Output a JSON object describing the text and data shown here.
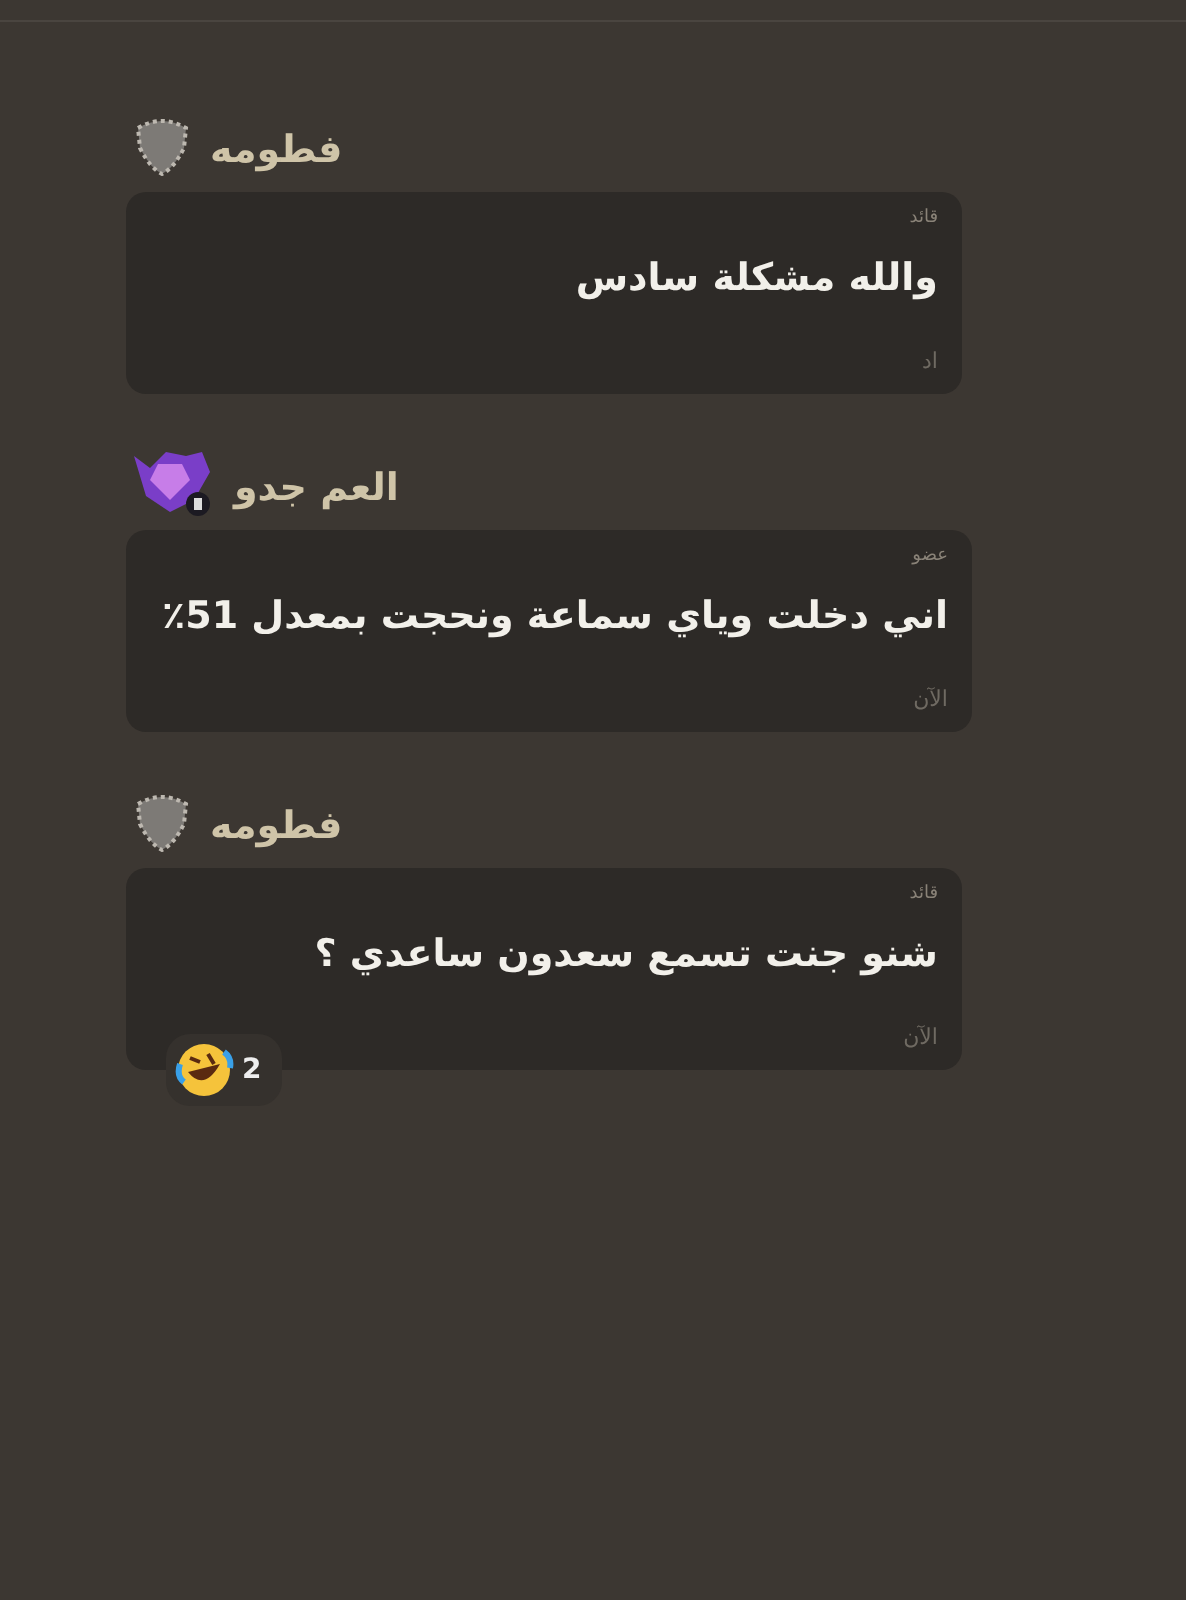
{
  "messages": [
    {
      "author": "فطومه",
      "avatar": {
        "kind": "shield"
      },
      "role": "قائد",
      "text": "والله مشكلة سادس",
      "time": "اد"
    },
    {
      "author": "العم جدو",
      "avatar": {
        "kind": "gem"
      },
      "role": "عضو",
      "text": "اني دخلت وياي سماعة ونحجت بمعدل 51٪",
      "time": "الآن"
    },
    {
      "author": "فطومه",
      "avatar": {
        "kind": "shield"
      },
      "role": "قائد",
      "text": "شنو جنت تسمع سعدون ساعدي ؟",
      "time": "الآن",
      "reactions": [
        {
          "count": "2"
        }
      ]
    }
  ]
}
